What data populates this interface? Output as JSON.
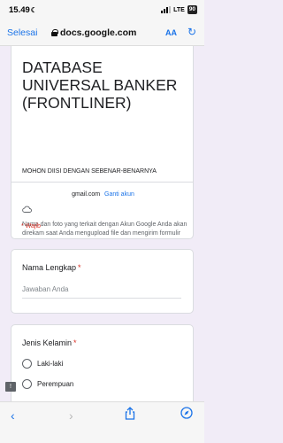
{
  "status_bar": {
    "time": "15.49",
    "network": "LTE",
    "battery": "90"
  },
  "browser": {
    "done_label": "Selesai",
    "url": "docs.google.com",
    "text_size_label": "AA"
  },
  "form": {
    "title": "DATABASE UNIVERSAL BANKER (FRONTLINER)",
    "description": "MOHON DIISI DENGAN SEBENAR-BENARNYA",
    "account_email": "gmail.com",
    "switch_account_label": "Ganti akun",
    "privacy_note": "Nama dan foto yang terkait dengan Akun Google Anda akan direkam saat Anda mengupload file dan mengirim formulir ini. Alamat email Anda bukan bagian dari respons Anda.",
    "required_note": "* Wajib"
  },
  "questions": {
    "name": {
      "label": "Nama Lengkap",
      "required_mark": "*",
      "placeholder": "Jawaban Anda"
    },
    "gender": {
      "label": "Jenis Kelamin",
      "required_mark": "*",
      "options": [
        "Laki-laki",
        "Perempuan"
      ]
    }
  },
  "icons": {
    "lock": "lock-icon",
    "reload": "reload-icon",
    "cloud": "cloud-icon",
    "feedback": "feedback-icon",
    "back": "back-icon",
    "forward": "forward-icon",
    "share": "share-icon",
    "compass": "compass-icon"
  },
  "colors": {
    "accent": "#1a73e8",
    "required": "#d93025",
    "form_bg": "#f1ecf7"
  }
}
